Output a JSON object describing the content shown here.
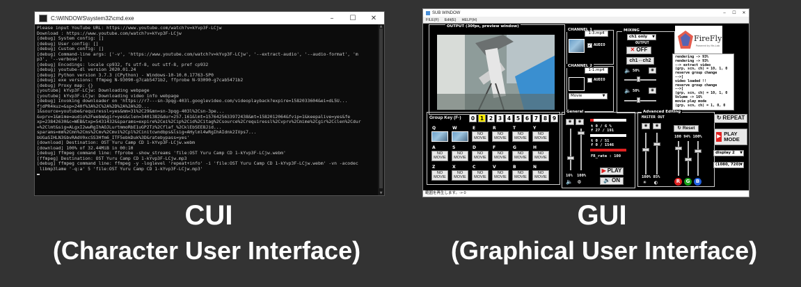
{
  "cui": {
    "window_title": "C:\\WINDOWS\\system32\\cmd.exe",
    "controls": {
      "minimize": "–",
      "maximize": "☐",
      "close": "✕"
    },
    "lines": [
      "Please input YouTube URL: https://www.youtube.com/watch?v=kYvp3F-LCjw",
      "Download : https://www.youtube.com/watch?v=kYvp3F-LCjw",
      "[debug] System config: []",
      "[debug] User config: []",
      "[debug] Custom config: []",
      "[debug] Command-line args: ['-v', 'https://www.youtube.com/watch?v=kYvp3F-LCjw', '--extract-audio', '--audio-format', 'm",
      "p3', '--verbose']",
      "[debug] Encodings: locale cp932, fs utf-8, out utf-8, pref cp932",
      "[debug] youtube-dl version 2020.01.24",
      "[debug] Python version 3.7.3 (CPython) - Windows-10-10.0.17763-SP0",
      "[debug] exe versions: ffmpeg N-93090-g7cab5471b2, ffprobe N-93090-g7cab5471b2",
      "[debug] Proxy map: {}",
      "[youtube] kYvp3F-LCjw: Downloading webpage",
      "[youtube] kYvp3F-LCjw: Downloading video info webpage",
      "[debug] Invoking downloader on 'https://r7---sn-3pqg-403l.googlevideo.com/videoplayback?expire=1582033604&ei=dL5U...",
      "fjdPR4kuz=&sp=240f%3A%2C%2A%2D%2A%2A%2D...",
      "1&source=youtube&requiressl=yes&mm=31%2C29&mn=sn-3pqg-403l%2Csn-3pe...",
      "&vprv=1&mime=audio%2Fwebm&gir=yes&clen=3401382&dur=257.161&lmt=1576425633972438&mt=1582012064&fvip=1&keepalive=yes&fe",
      "xp=23842630&c=WEB&txp=5431432&sparams=expire%2Cei%2Cip%2Cid%2Citag%2Csource%2Crequiressl%2Cvprv%2Cmime%2Cgir%2Cclen%2Cdur",
      "=%2Clmt&sig=ALgxI2wwRgIhAOJLurtmmoRbE1uGP2Tz%2Cflaf_%2CklEbSEE8Jid...",
      "sparams=mm%2Cmn%2Cms%2Cmv%2Cmvi%2Cpl%2Cinitcwndbps&lsig=AHylml4wRgIhAIdnk2IVps7...",
      "bUGaSIHLN3GbvRAdV0xcSS3Hfm6_ITF5ebkDuk%3D&ratebypass=yes'",
      "[download] Destination: OST Yuru Camp CD 1-kYvp3F-LCjw.webm",
      "[download] 100% of 32.44MiB in 00:10",
      "[debug] ffmpeg command line: ffprobe -show_streams 'file:OST Yuru Camp CD 1-kYvp3F-LCjw.webm'",
      "[ffmpeg] Destination: OST Yuru Camp CD 1-kYvp3F-LCjw.mp3",
      "[debug] ffmpeg command line: ffmpeg -y -loglevel 'repeat+info' -i 'file:OST Yuru Camp CD 1-kYvp3F-LCjw.webm' -vn -acodec",
      " libmp3lame '-q:a' 5 'file:OST Yuru Camp CD 1-kYvp3F-LCjw.mp3'"
    ]
  },
  "gui": {
    "window_title": "SUB WINDOW",
    "controls": {
      "minimize": "–",
      "maximize": "☐",
      "close": "✕"
    },
    "menu": [
      "FILE(F)",
      "Edit(E)",
      "HELP(H)"
    ],
    "output_label": "OUTPUT (30fps, preview window)",
    "channel1": {
      "label": "CHANNEL 1",
      "file": "1-3.mp4",
      "audio": "AUDIO"
    },
    "channel2": {
      "label": "CHANNEL 2",
      "file": "1-1.mp4",
      "audio": "AUDIO",
      "source": "Movie"
    },
    "mixing": {
      "label": "MIXING",
      "mode": "ch1 only",
      "output": "OUTPUT",
      "off": "OFF",
      "switch": "ch1⇔ch2",
      "pct1": "50%",
      "pct2": "50%"
    },
    "logo": {
      "text": "FireFly",
      "sub": "Powered by Ma-Lab"
    },
    "log": [
      "rendering -> 93%",
      "rendering -> 93%",
      "--> extract video",
      "(grp, scn, ch) = 10, 1, 0",
      "reserve group change",
      "-->]",
      "video loaded !!",
      "reserve group change",
      "-->]",
      "(grp, scn, ch) = 10, 1, 0",
      "Volume -> 16%",
      "movie play mode",
      "(grp, scn, ch) = 1, 0, 0"
    ],
    "group_key": {
      "label": "Group Key (F-)",
      "keys": [
        "0",
        "1",
        "2",
        "3",
        "4",
        "5",
        "6",
        "7",
        "8",
        "9"
      ],
      "active": "1"
    },
    "movie_rows": [
      {
        "keys": [
          "Q",
          "W",
          "E",
          "R",
          "T",
          "Y"
        ]
      },
      {
        "keys": [
          "A",
          "S",
          "D",
          "F",
          "G",
          "H"
        ]
      },
      {
        "keys": [
          "Z",
          "X",
          "C",
          "V",
          "B",
          "N"
        ]
      }
    ],
    "movie_btn": "NO MOVIE",
    "general": {
      "label": "General",
      "stats": [
        "t 0 /  6  %",
        "f 27 / 191",
        "t 0 / 51",
        "f 0 / 1546"
      ],
      "fr_rate": "FR_rate : 100",
      "vol1": "16%",
      "vol2": "100%",
      "play": "PLAY",
      "on": "ON"
    },
    "advanced": {
      "label": "Advanced Editing",
      "master": "MASTER OUT",
      "reset": "Reset",
      "pcts": "100 94% 100%",
      "pcts2": "100% 85%",
      "rgb": [
        "R",
        "G",
        "B"
      ]
    },
    "right": {
      "repeat": "REPEAT",
      "play_mode": "PLAY MODE",
      "display": "display 2",
      "resolution": "(1080, 720)"
    },
    "status": "範囲を再生します。-> 0"
  },
  "captions": {
    "cui_title": "CUI",
    "cui_sub": "(Character User Interface)",
    "gui_title": "GUI",
    "gui_sub": "(Graphical User Interface)"
  }
}
